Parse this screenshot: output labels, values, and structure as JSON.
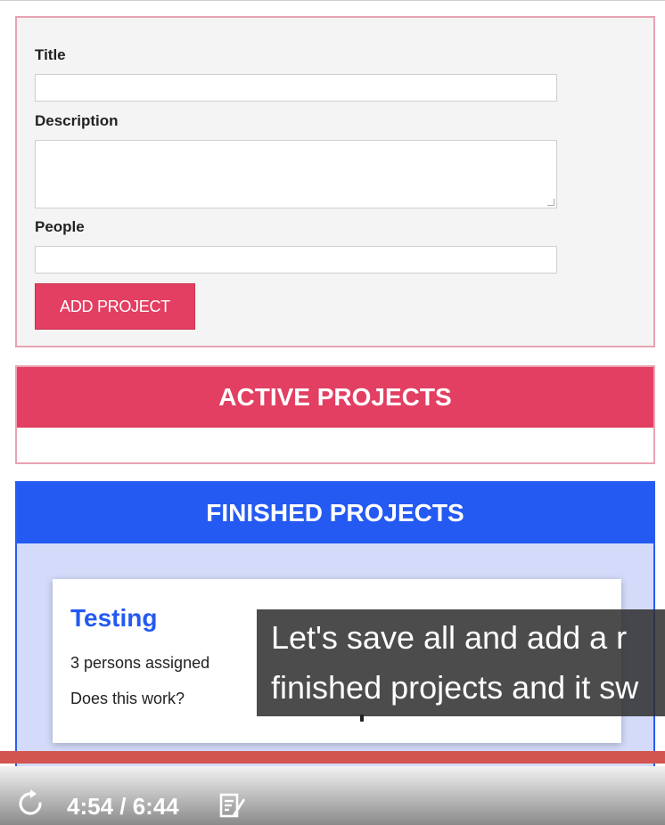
{
  "form": {
    "title_label": "Title",
    "description_label": "Description",
    "people_label": "People",
    "title_value": "",
    "description_value": "",
    "people_value": "",
    "submit_label": "ADD PROJECT"
  },
  "active_projects": {
    "heading": "ACTIVE PROJECTS",
    "items": []
  },
  "finished_projects": {
    "heading": "FINISHED PROJECTS",
    "items": [
      {
        "title": "Testing",
        "assigned": "3 persons assigned",
        "description": "Does this work?"
      }
    ]
  },
  "video": {
    "caption_line1": "Let's save all and add a r",
    "caption_line2": "finished projects and it sw",
    "time_display": "4:54 / 6:44",
    "progress_color": "#d25550"
  },
  "colors": {
    "accent_pink": "#e23f62",
    "accent_blue": "#245af2"
  },
  "icons": {
    "replay": "replay-icon",
    "notes": "notes-icon"
  }
}
